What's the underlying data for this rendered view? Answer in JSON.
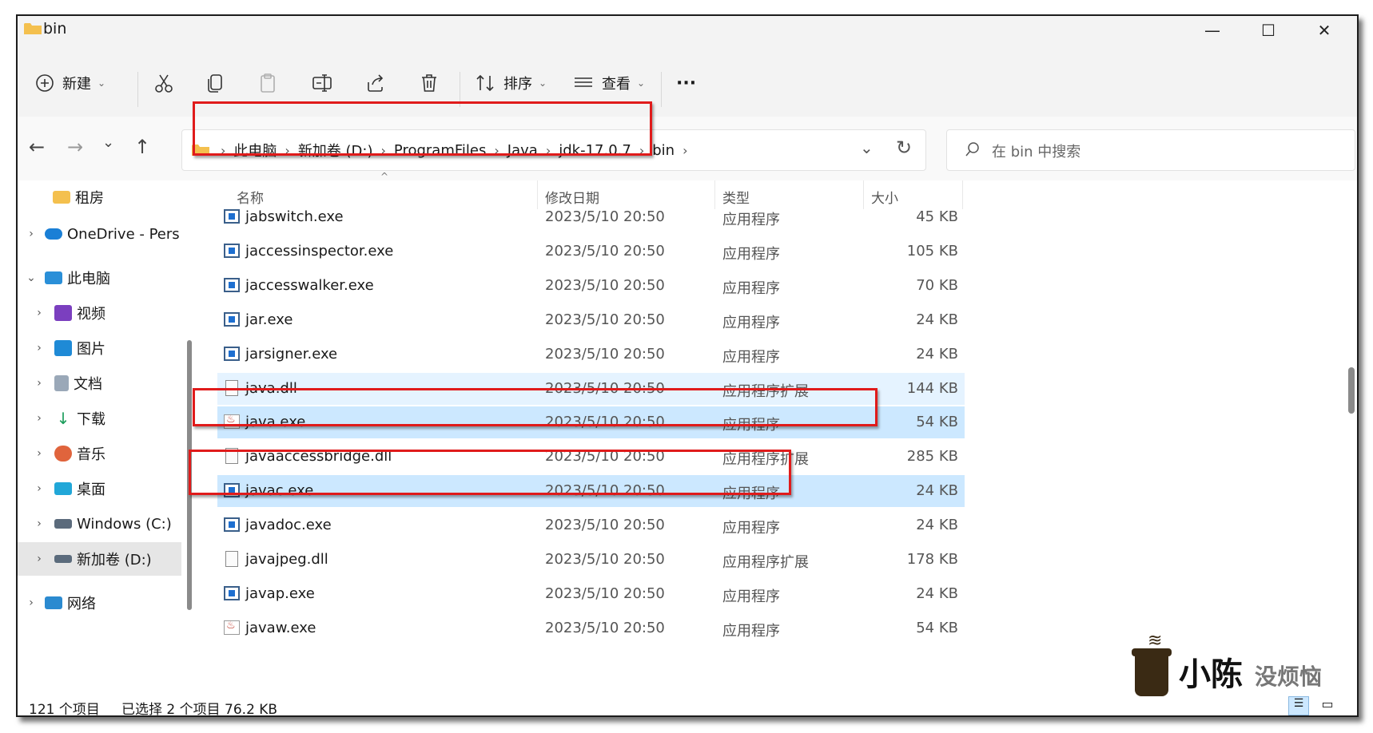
{
  "window": {
    "title": "bin",
    "minimize": "—",
    "maximize": "☐",
    "close": "✕"
  },
  "toolbar": {
    "new_label": "新建",
    "sort_label": "排序",
    "view_label": "查看",
    "more": "···"
  },
  "nav": {
    "back": "←",
    "forward": "→",
    "recent": "⌄",
    "up": "↑",
    "refresh": "↻",
    "dropdown": "⌄"
  },
  "breadcrumbs": [
    "此电脑",
    "新加卷 (D:)",
    "ProgramFiles",
    "Java",
    "jdk-17.0.7",
    "bin"
  ],
  "search": {
    "placeholder": "在 bin 中搜索"
  },
  "sidebar": {
    "items": [
      {
        "label": "租房",
        "icon": "folder-icon"
      },
      {
        "label": "OneDrive - Pers",
        "icon": "cloud-icon"
      },
      {
        "label": "此电脑",
        "icon": "computer-icon"
      },
      {
        "label": "视频",
        "icon": "video-icon"
      },
      {
        "label": "图片",
        "icon": "picture-icon"
      },
      {
        "label": "文档",
        "icon": "document-icon"
      },
      {
        "label": "下载",
        "icon": "download-icon"
      },
      {
        "label": "音乐",
        "icon": "music-icon"
      },
      {
        "label": "桌面",
        "icon": "desktop-icon"
      },
      {
        "label": "Windows (C:)",
        "icon": "drive-icon"
      },
      {
        "label": "新加卷 (D:)",
        "icon": "drive-icon"
      },
      {
        "label": "网络",
        "icon": "network-icon"
      }
    ]
  },
  "columns": {
    "name": "名称",
    "date": "修改日期",
    "type": "类型",
    "size": "大小"
  },
  "files": [
    {
      "name": "jabswitch.exe",
      "date": "2023/5/10 20:50",
      "type": "应用程序",
      "size": "45 KB",
      "icon": "exe"
    },
    {
      "name": "jaccessinspector.exe",
      "date": "2023/5/10 20:50",
      "type": "应用程序",
      "size": "105 KB",
      "icon": "exe"
    },
    {
      "name": "jaccesswalker.exe",
      "date": "2023/5/10 20:50",
      "type": "应用程序",
      "size": "70 KB",
      "icon": "exe"
    },
    {
      "name": "jar.exe",
      "date": "2023/5/10 20:50",
      "type": "应用程序",
      "size": "24 KB",
      "icon": "exe"
    },
    {
      "name": "jarsigner.exe",
      "date": "2023/5/10 20:50",
      "type": "应用程序",
      "size": "24 KB",
      "icon": "exe"
    },
    {
      "name": "java.dll",
      "date": "2023/5/10 20:50",
      "type": "应用程序扩展",
      "size": "144 KB",
      "icon": "dll"
    },
    {
      "name": "java.exe",
      "date": "2023/5/10 20:50",
      "type": "应用程序",
      "size": "54 KB",
      "icon": "java"
    },
    {
      "name": "javaaccessbridge.dll",
      "date": "2023/5/10 20:50",
      "type": "应用程序扩展",
      "size": "285 KB",
      "icon": "dll"
    },
    {
      "name": "javac.exe",
      "date": "2023/5/10 20:50",
      "type": "应用程序",
      "size": "24 KB",
      "icon": "exe"
    },
    {
      "name": "javadoc.exe",
      "date": "2023/5/10 20:50",
      "type": "应用程序",
      "size": "24 KB",
      "icon": "exe"
    },
    {
      "name": "javajpeg.dll",
      "date": "2023/5/10 20:50",
      "type": "应用程序扩展",
      "size": "178 KB",
      "icon": "dll"
    },
    {
      "name": "javap.exe",
      "date": "2023/5/10 20:50",
      "type": "应用程序",
      "size": "24 KB",
      "icon": "exe"
    },
    {
      "name": "javaw.exe",
      "date": "2023/5/10 20:50",
      "type": "应用程序",
      "size": "54 KB",
      "icon": "java"
    }
  ],
  "status": {
    "count": "121 个项目",
    "selected": "已选择 2 个项目  76.2 KB"
  },
  "watermark": {
    "text1": "小陈",
    "text2": "没烦恼"
  },
  "colors": {
    "selection": "#cce8ff",
    "hover": "#e5f3ff",
    "highlight": "#e01b1b"
  }
}
